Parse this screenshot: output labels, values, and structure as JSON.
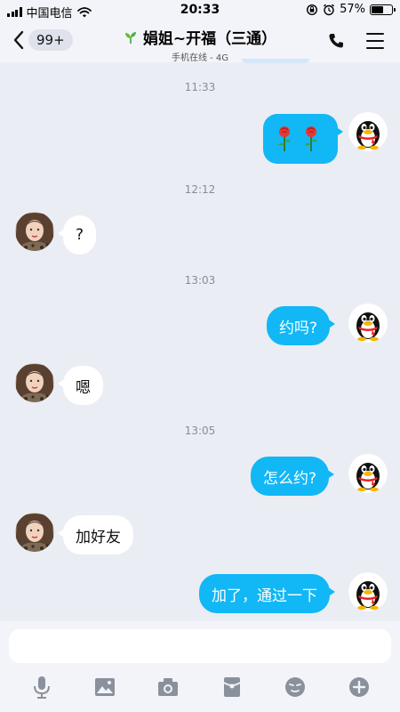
{
  "status_bar": {
    "carrier": "中国电信",
    "time": "20:33",
    "battery": "57%",
    "battery_level": 0.57
  },
  "header": {
    "back_badge": "99+",
    "contact_name": "娟姐~开福（三通）",
    "status": "手机在线 - 4G"
  },
  "messages": [
    {
      "time": "11:33"
    },
    {
      "sender": "me",
      "content": "rose-emoji x2"
    },
    {
      "time": "12:12"
    },
    {
      "sender": "them",
      "text": "?"
    },
    {
      "time": "13:03"
    },
    {
      "sender": "me",
      "text": "约吗?"
    },
    {
      "sender": "them",
      "text": "嗯"
    },
    {
      "time": "13:05"
    },
    {
      "sender": "me",
      "text": "怎么约?"
    },
    {
      "sender": "them",
      "text": "加好友"
    },
    {
      "sender": "me",
      "text": "加了，通过一下"
    }
  ],
  "chat": {
    "t1": "11:33",
    "t2": "12:12",
    "t3": "13:03",
    "t4": "13:05",
    "m_q": "?",
    "m_yue": "约吗?",
    "m_en": "嗯",
    "m_how": "怎么约?",
    "m_add": "加好友",
    "m_added": "加了，通过一下"
  },
  "toolbar": {
    "icons": [
      "microphone-icon",
      "image-icon",
      "camera-icon",
      "red-packet-icon",
      "emoji-icon",
      "plus-icon"
    ]
  },
  "colors": {
    "bubble_mine": "#12b7f5",
    "bubble_theirs": "#ffffff",
    "background": "#eaedf4",
    "bar": "#f3f4f9"
  }
}
